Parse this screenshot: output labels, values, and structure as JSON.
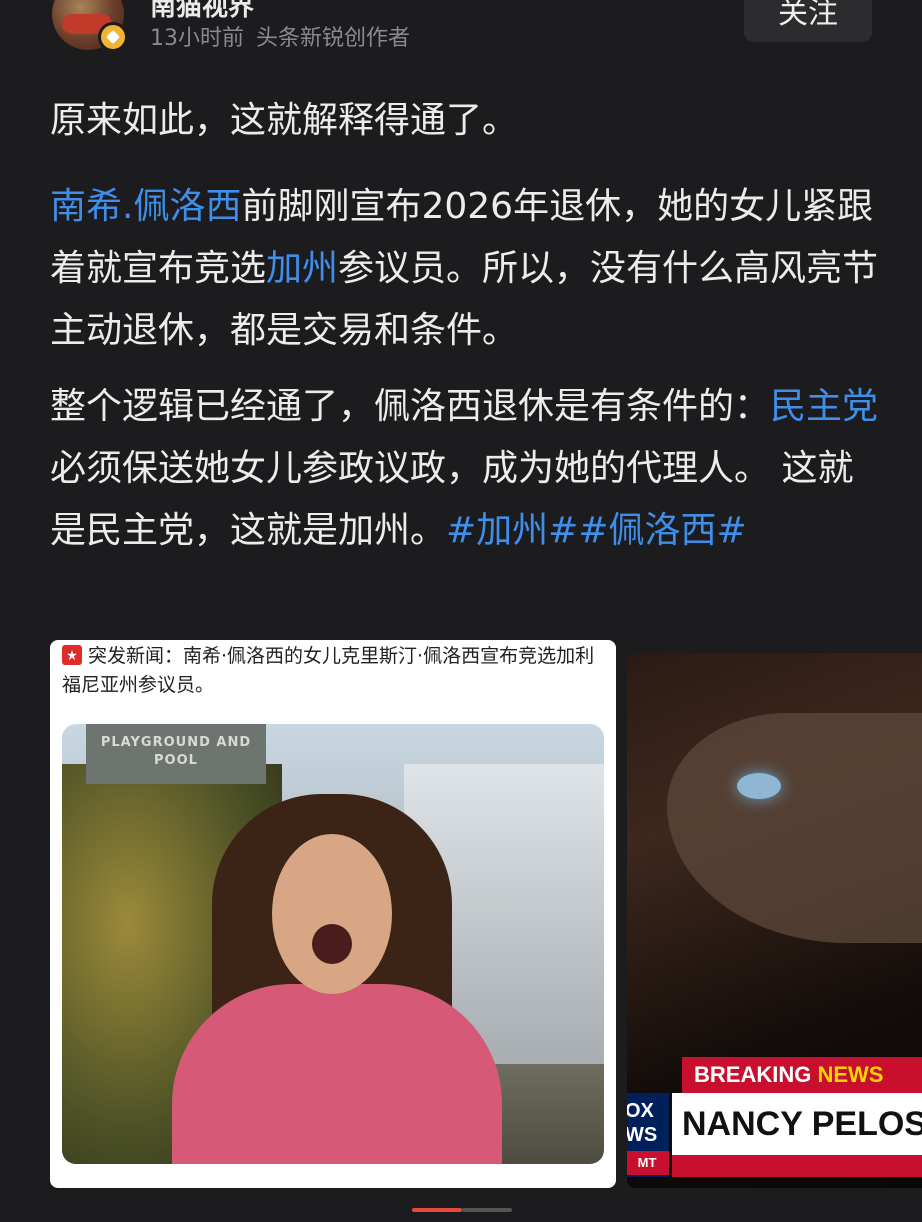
{
  "author": {
    "name": "南猫视界",
    "time": "13小时前",
    "title": "头条新锐创作者",
    "follow_label": "关注"
  },
  "post": {
    "p1": "原来如此，这就解释得通了。",
    "p2": {
      "link1": "南希.佩洛西",
      "text1": "前脚刚宣布2026年退休，她的女儿紧跟着就宣布竞选",
      "link2": "加州",
      "text2": "参议员。所以，没有什么高风亮节主动退休，都是交易和条件。"
    },
    "p3": {
      "text1": "整个逻辑已经通了，佩洛西退休是有条件的：",
      "link1": "民主党",
      "text2": "必须保送她女儿参政议政，成为她的代理人。 这就是民主党，这就是加州。",
      "tag1": "#加州#",
      "tag2": "#佩洛西#"
    }
  },
  "image1": {
    "caption": "突发新闻：南希·佩洛西的女儿克里斯汀·佩洛西宣布竞选加利福尼亚州参议员。",
    "sign_text": "PLAYGROUND AND POOL"
  },
  "image2": {
    "breaking": "BREAKING",
    "news": "NEWS",
    "name": "NANCY PELOS",
    "logo_top": "OX",
    "logo_mid": "WS",
    "logo_bottom": "MT"
  },
  "colors": {
    "background": "#1c1c1e",
    "link": "#3f8ee9",
    "text": "#ececec"
  }
}
